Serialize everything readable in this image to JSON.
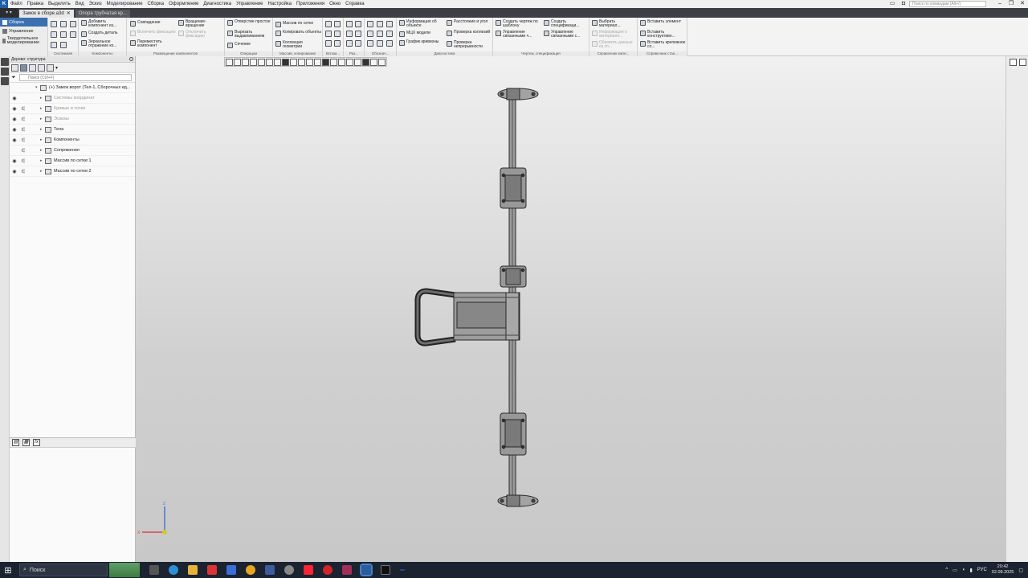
{
  "menubar": {
    "logo": "K",
    "items": [
      "Файл",
      "Правка",
      "Выделить",
      "Вид",
      "Эскиз",
      "Моделирование",
      "Сборка",
      "Оформление",
      "Диагностика",
      "Управление",
      "Настройка",
      "Приложения",
      "Окно",
      "Справка"
    ],
    "command_search_placeholder": "Поиск по командам (Alt+/)"
  },
  "doc_tabs": [
    {
      "label": "Замок в сборе.a3d",
      "active": true
    },
    {
      "label": "Опора трубчатая кр...",
      "active": false
    }
  ],
  "mode_tabs": [
    "Сборка",
    "Управление",
    "Твердотельное моделирование"
  ],
  "ribbon": {
    "groups": {
      "system": "Системная",
      "components": "Компоненты",
      "placement": "Размещение компонентов",
      "operations": "Операции",
      "array": "Массив, копирование",
      "aux": "Вспом...",
      "size": "Раз...",
      "marks": "Обознач...",
      "diagnostics": "Диагностика",
      "drawing": "Чертеж, спецификация",
      "ref_mat": "Справочник мате...",
      "ref_std": "Справочник стан..."
    },
    "buttons": {
      "add_component": "Добавить компонент из...",
      "create_part": "Создать деталь",
      "mirror": "Зеркальное отражение ко...",
      "coincidence": "Совпадение",
      "enable_fix": "Включить фиксацию",
      "move_component": "Переместить компонент",
      "rotation": "Вращение-вращение",
      "disable_fix": "Отключить фиксацию",
      "hole_simple": "Отверстие простое",
      "cut_extrude": "Вырезать выдавливанием",
      "section": "Сечение",
      "grid_array": "Массив по сетке",
      "copy_objects": "Копировать объекты",
      "geometry_collection": "Коллекция геометрии",
      "object_info": "Информация об объекте",
      "mass_props": "МЦХ модели",
      "curvature_graph": "График кривизны",
      "distance_angle": "Расстояние и угол",
      "check_collisions": "Проверка коллизий",
      "check_continuity": "Проверка непрерывности",
      "create_drawing": "Создать чертеж по шаблону",
      "manage_linked": "Управление связанными ч...",
      "create_spec": "Создать спецификаци...",
      "manage_linked_spec": "Управление связанными с...",
      "choose_material": "Выбрать материал...",
      "material_info": "Информация о материале...",
      "update_material": "Обновить данные из сп...",
      "insert_element": "Вставить элемент",
      "insert_design": "Вставить конструктивн...",
      "insert_fastener": "Вставить крепежное со..."
    }
  },
  "tree_panel": {
    "title": "Дерево: структура",
    "search_placeholder": "Поиск (Ctrl+F)",
    "root": "(+) Замок ворот (Тел-1, Сборочных ед...",
    "rows": [
      {
        "label": "Системы координат",
        "dim": true,
        "eye": true,
        "lock": false
      },
      {
        "label": "Кривые и точки",
        "dim": true,
        "eye": true,
        "lock": true
      },
      {
        "label": "Эскизы",
        "dim": true,
        "eye": true,
        "lock": true
      },
      {
        "label": "Тела",
        "dim": false,
        "eye": true,
        "lock": true
      },
      {
        "label": "Компоненты",
        "dim": false,
        "eye": true,
        "lock": true
      },
      {
        "label": "Сопряжения",
        "dim": false,
        "eye": false,
        "lock": true
      },
      {
        "label": "Массив по сетке:1",
        "dim": false,
        "eye": true,
        "lock": true
      },
      {
        "label": "Массив по сетке:2",
        "dim": false,
        "eye": true,
        "lock": true
      }
    ],
    "formula_icon": "fx"
  },
  "viewport": {
    "axis_labels": {
      "x": "X",
      "z": "Z"
    }
  },
  "taskbar": {
    "search_label": "Поиск",
    "language": "РУС",
    "time": "20:42",
    "date": "02.09.2025"
  },
  "colors": {
    "accent": "#3b6fb0",
    "taskbar": "#1b2230",
    "model_fill": "#8a8a8a",
    "model_stroke": "#2a2a2a"
  }
}
